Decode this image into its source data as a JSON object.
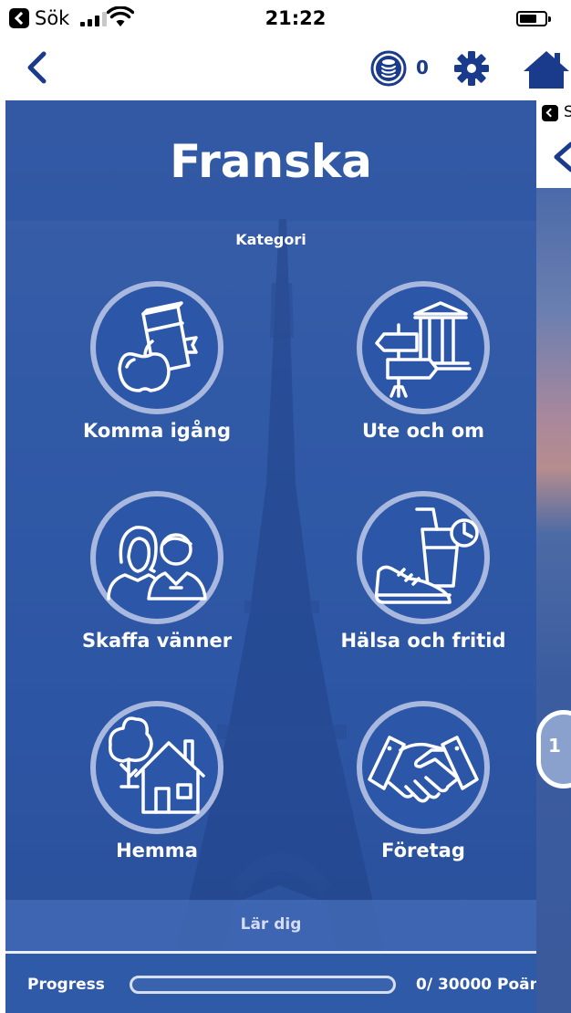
{
  "status_bar": {
    "carrier": "Sök",
    "time": "21:22"
  },
  "nav": {
    "coins": "0"
  },
  "page": {
    "title": "Franska",
    "subtitle": "Kategori"
  },
  "categories": [
    {
      "label": "Komma igång",
      "icon": "book-apple-icon"
    },
    {
      "label": "Ute och om",
      "icon": "signpost-building-icon"
    },
    {
      "label": "Skaffa vänner",
      "icon": "people-icon"
    },
    {
      "label": "Hälsa och fritid",
      "icon": "drink-sneaker-icon"
    },
    {
      "label": "Hemma",
      "icon": "house-tree-icon"
    },
    {
      "label": "Företag",
      "icon": "handshake-icon"
    }
  ],
  "learn": {
    "label": "Lär dig"
  },
  "progress": {
    "label": "Progress",
    "value_text": "0/ 30000 Poäng",
    "fraction": 0.0
  },
  "peek": {
    "status_text": "S",
    "bubble": "1"
  },
  "colors": {
    "accent": "#1a3a8c",
    "panel": "#2f5aa8",
    "ring": "#a9b8df"
  }
}
